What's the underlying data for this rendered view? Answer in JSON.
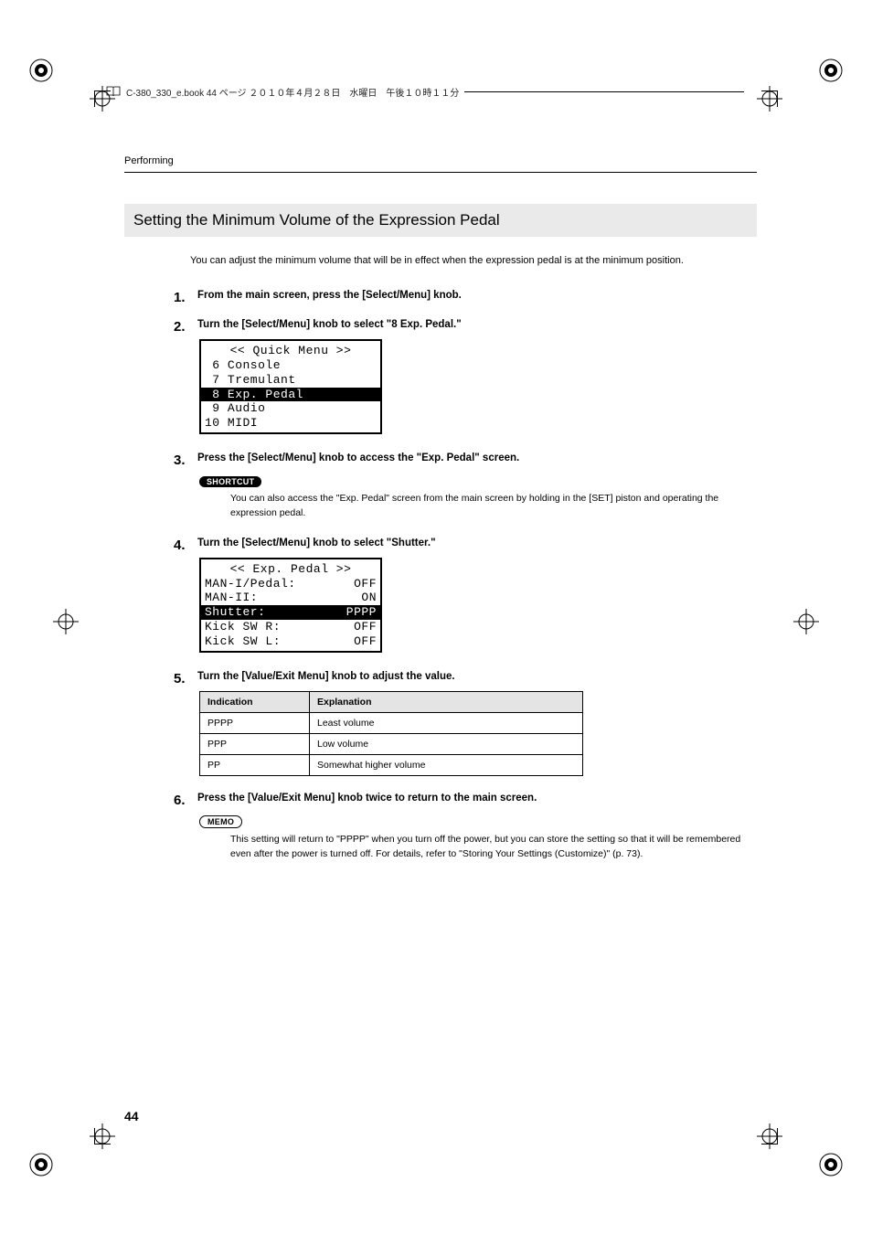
{
  "imposition_line": "C-380_330_e.book  44 ページ  ２０１０年４月２８日　水曜日　午後１０時１１分",
  "running_head": "Performing",
  "section_title": "Setting the Minimum Volume of the Expression Pedal",
  "intro": "You can adjust the minimum volume that will be in effect when the expression pedal is at the minimum position.",
  "steps": {
    "s1": {
      "num": "1.",
      "text": "From the main screen, press the [Select/Menu] knob."
    },
    "s2": {
      "num": "2.",
      "text": "Turn the [Select/Menu] knob to select \"8 Exp. Pedal.\""
    },
    "s3": {
      "num": "3.",
      "text": "Press the [Select/Menu] knob to access the \"Exp. Pedal\" screen."
    },
    "s4": {
      "num": "4.",
      "text": "Turn the [Select/Menu] knob to select \"Shutter.\""
    },
    "s5": {
      "num": "5.",
      "text": "Turn the [Value/Exit Menu] knob to adjust the value."
    },
    "s6": {
      "num": "6.",
      "text": "Press the [Value/Exit Menu] knob twice to return to the main screen."
    }
  },
  "lcd1": {
    "title": "<< Quick Menu >>",
    "rows": [
      {
        "l": " 6 Console",
        "sel": false
      },
      {
        "l": " 7 Tremulant",
        "sel": false
      },
      {
        "l": " 8 Exp. Pedal",
        "sel": true
      },
      {
        "l": " 9 Audio",
        "sel": false
      },
      {
        "l": "10 MIDI",
        "sel": false
      }
    ]
  },
  "lcd2": {
    "title": "<< Exp. Pedal >>",
    "rows": [
      {
        "l": "MAN-I/Pedal:",
        "r": "OFF",
        "sel": false
      },
      {
        "l": "MAN-II:",
        "r": "ON",
        "sel": false
      },
      {
        "l": "Shutter:",
        "r": "PPPP",
        "sel": true
      },
      {
        "l": "Kick SW R:",
        "r": "OFF",
        "sel": false
      },
      {
        "l": "Kick SW L:",
        "r": "OFF",
        "sel": false
      }
    ]
  },
  "shortcut": {
    "label": "SHORTCUT",
    "text": "You can also access the \"Exp. Pedal\" screen from the main screen by holding in the [SET] piston and operating the expression pedal."
  },
  "value_table": {
    "headers": [
      "Indication",
      "Explanation"
    ],
    "rows": [
      [
        "PPPP",
        "Least volume"
      ],
      [
        "PPP",
        "Low volume"
      ],
      [
        "PP",
        "Somewhat higher volume"
      ]
    ]
  },
  "memo": {
    "label": "MEMO",
    "text": "This setting will return to \"PPPP\" when you turn off the power, but you can store the setting so that it will be remembered even after the power is turned off. For details, refer to \"Storing Your Settings (Customize)\" (p. 73)."
  },
  "page_number": "44"
}
